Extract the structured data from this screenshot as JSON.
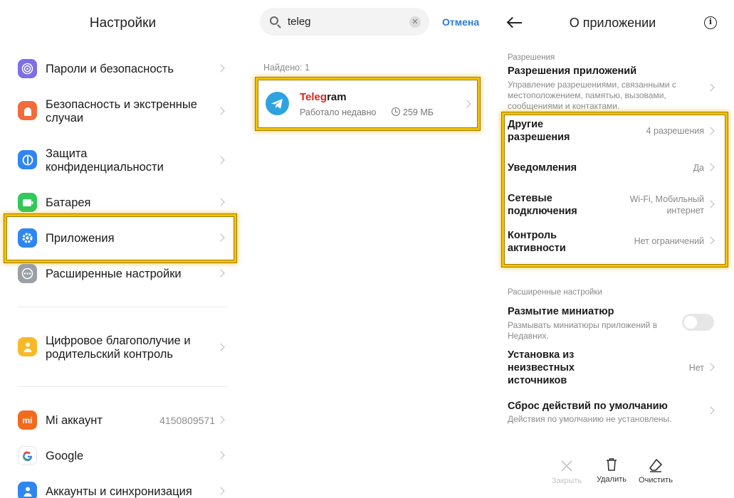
{
  "settings": {
    "title": "Настройки",
    "items": [
      {
        "label": "Пароли и безопасность",
        "icon": "fingerprint-icon",
        "color": "#7c6ee6"
      },
      {
        "label": "Безопасность и экстренные случаи",
        "icon": "sos-icon",
        "color": "#f26b3a"
      },
      {
        "label": "Защита конфиденциальности",
        "icon": "privacy-icon",
        "color": "#2f86f0"
      },
      {
        "label": "Батарея",
        "icon": "battery-icon",
        "color": "#30c95a"
      },
      {
        "label": "Приложения",
        "icon": "gear-icon",
        "color": "#2f86f0"
      },
      {
        "label": "Расширенные настройки",
        "icon": "more-icon",
        "color": "#9aa0a6"
      },
      {
        "label": "Цифровое благополучие и родительский контроль",
        "icon": "wellbeing-icon",
        "color": "#f7b928"
      },
      {
        "label": "Mi аккаунт",
        "value": "4150809571",
        "icon": "mi-icon",
        "color": "#f26b1d"
      },
      {
        "label": "Google",
        "icon": "google-icon",
        "color": "#ffffff"
      },
      {
        "label": "Аккаунты и синхронизация",
        "icon": "account-icon",
        "color": "#2f86f0"
      }
    ]
  },
  "search": {
    "query": "teleg",
    "cancel_label": "Отмена",
    "found_label": "Найдено: 1",
    "result": {
      "title_match": "Teleg",
      "title_rest": "ram",
      "status": "Работало недавно",
      "size": "259 МБ"
    }
  },
  "app_info": {
    "title": "О приложении",
    "permissions_section": "Разрешения",
    "app_permissions": {
      "label": "Разрешения приложений",
      "desc": "Управление разрешениями, связанными с местоположением, памятью, вызовами, сообщениями и контактами."
    },
    "rows": [
      {
        "label": "Другие разрешения",
        "value": "4 разрешения"
      },
      {
        "label": "Уведомления",
        "value": "Да"
      },
      {
        "label": "Сетевые подключения",
        "value": "Wi-Fi, Мобильный интернет"
      },
      {
        "label": "Контроль активности",
        "value": "Нет ограничений"
      }
    ],
    "advanced_section": "Расширенные настройки",
    "blur": {
      "label": "Размытие миниатюр",
      "desc": "Размывать миниатюры приложений в Недавних.",
      "enabled": false
    },
    "unknown_sources": {
      "label": "Установка из неизвестных источников",
      "value": "Нет"
    },
    "reset_defaults": {
      "label": "Сброс действий по умолчанию",
      "desc": "Действия по умолчанию не установлены."
    },
    "bottom_bar": {
      "close": "Закрыть",
      "delete": "Удалить",
      "clear": "Очистить"
    }
  },
  "colors": {
    "highlight": "#f2c200",
    "accent": "#2b7bd8",
    "search_match": "#e0221b",
    "telegram": "#2fa3e0"
  }
}
